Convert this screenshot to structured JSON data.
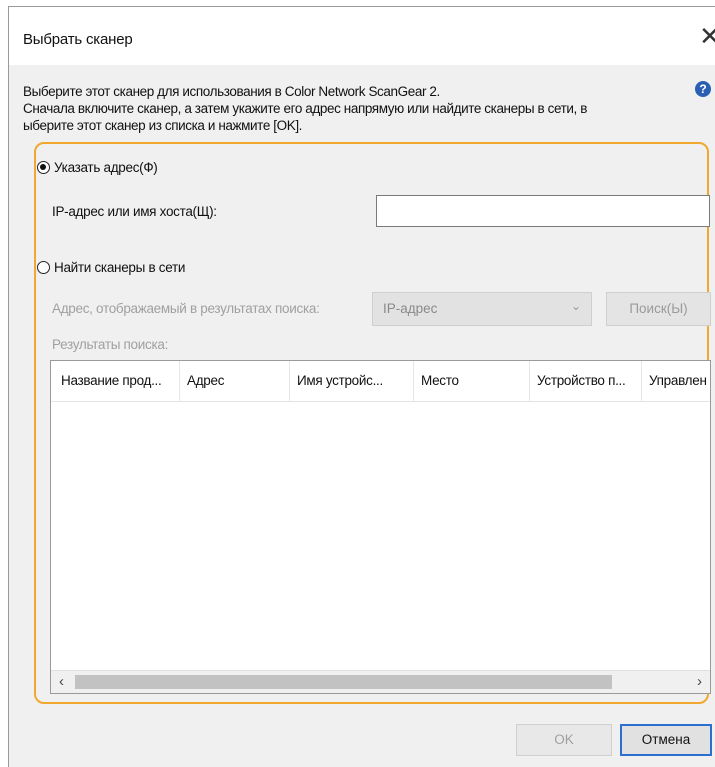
{
  "window": {
    "title": "Выбрать сканер",
    "close_glyph": "✕"
  },
  "description": {
    "line1": "Выберите этот сканер для использования в Color Network ScanGear 2.",
    "line2": "Сначала включите сканер, а затем укажите его адрес напрямую или найдите сканеры в сети, в",
    "line3": "ыберите этот сканер из списка и нажмите [OK].",
    "help_icon": "help-icon",
    "help_glyph": "?"
  },
  "specify_address": {
    "label": "Указать адрес(Ф)",
    "selected": true,
    "ip_label": "IP-адрес или имя хоста(Щ):",
    "ip_value": ""
  },
  "find_scanners": {
    "label": "Найти сканеры в сети",
    "selected": false,
    "address_label": "Адрес, отображаемый в результатах поиска:",
    "address_value": "IP-адрес",
    "search_button": "Поиск(Ы)",
    "results_label": "Результаты поиска:",
    "columns": [
      "Название прод...",
      "Адрес",
      "Имя устройс...",
      "Место",
      "Устройство п...",
      "Управлен"
    ],
    "rows": []
  },
  "buttons": {
    "ok": "OK",
    "cancel": "Отмена"
  },
  "colors": {
    "group_border": "#f0a92e",
    "focus_border": "#2c6fd1",
    "help_icon": "#2a5fb4"
  }
}
